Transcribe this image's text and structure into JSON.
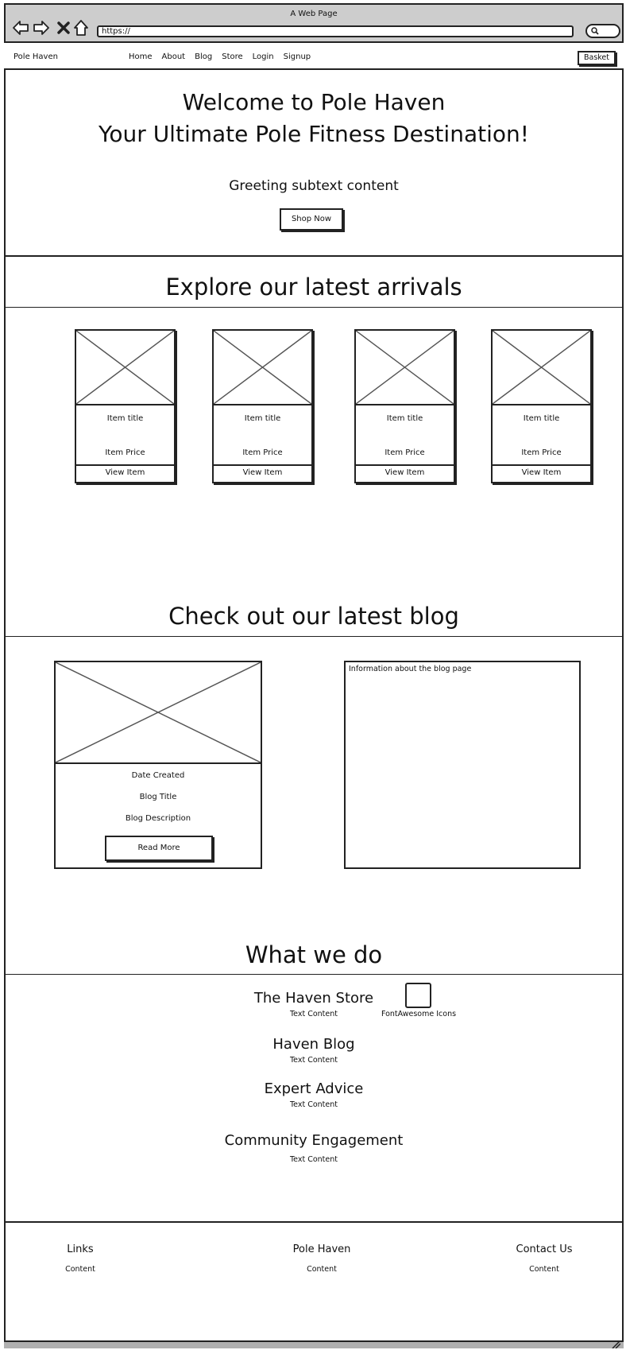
{
  "window": {
    "title": "A Web Page",
    "url": "https://"
  },
  "nav": {
    "brand": "Pole Haven",
    "links": [
      "Home",
      "About",
      "Blog",
      "Store",
      "Login",
      "Signup"
    ],
    "basket": "Basket"
  },
  "hero": {
    "title_line1": "Welcome to Pole Haven",
    "title_line2": "Your Ultimate Pole Fitness Destination!",
    "subtext": "Greeting subtext content",
    "cta": "Shop Now"
  },
  "arrivals": {
    "heading": "Explore our latest arrivals",
    "items": [
      {
        "title": "Item title",
        "price": "Item Price",
        "button": "View Item"
      },
      {
        "title": "Item title",
        "price": "Item Price",
        "button": "View Item"
      },
      {
        "title": "Item title",
        "price": "Item Price",
        "button": "View Item"
      },
      {
        "title": "Item title",
        "price": "Item Price",
        "button": "View Item"
      }
    ]
  },
  "blog": {
    "heading": "Check out our latest blog",
    "date": "Date Created",
    "title": "Blog Title",
    "description": "Blog Description",
    "read_more": "Read More",
    "info": "Information about the blog page"
  },
  "what_we_do": {
    "heading": "What we do",
    "icon_label": "FontAwesome Icons",
    "items": [
      {
        "title": "The Haven Store",
        "text": "Text Content"
      },
      {
        "title": "Haven Blog",
        "text": "Text Content"
      },
      {
        "title": "Expert Advice",
        "text": "Text Content"
      },
      {
        "title": "Community Engagement",
        "text": "Text Content"
      }
    ]
  },
  "footer": {
    "columns": [
      {
        "title": "Links",
        "content": "Content"
      },
      {
        "title": "Pole Haven",
        "content": "Content"
      },
      {
        "title": "Contact Us",
        "content": "Content"
      }
    ]
  }
}
